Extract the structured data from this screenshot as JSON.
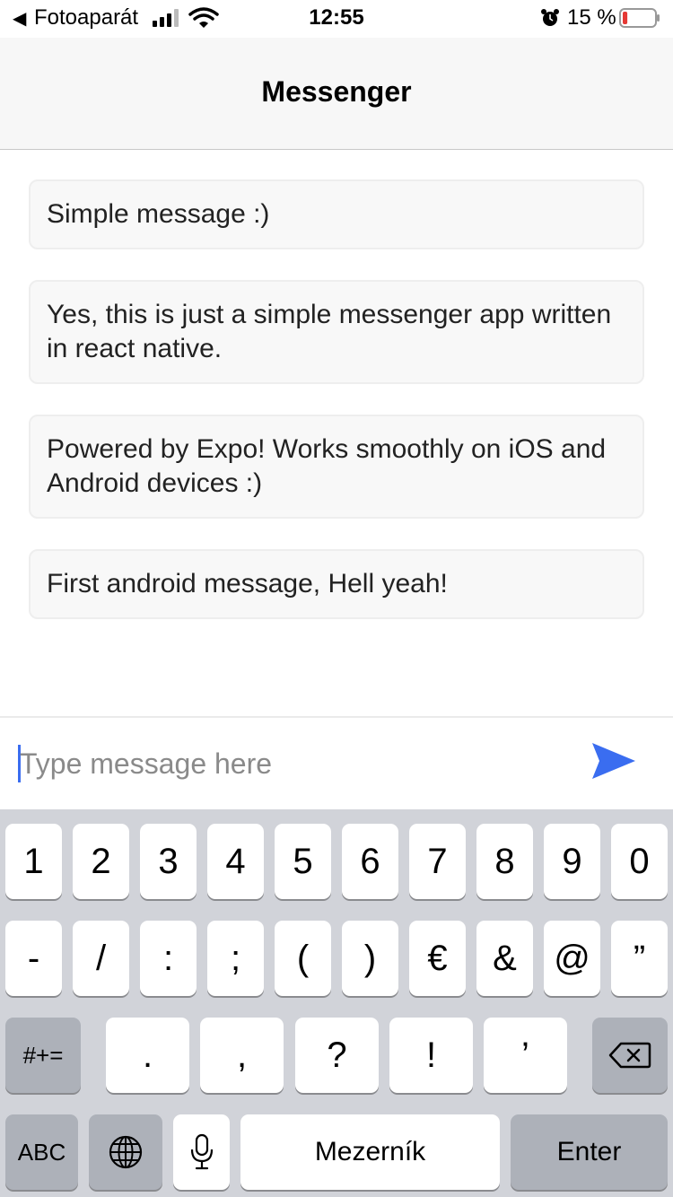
{
  "status_bar": {
    "back_app": "Fotoaparát",
    "time": "12:55",
    "battery_percent": "15 %",
    "battery_level": 0.15,
    "icons": [
      "back-arrow-icon",
      "signal-icon",
      "wifi-icon",
      "alarm-icon",
      "battery-icon"
    ]
  },
  "header": {
    "title": "Messenger"
  },
  "messages": [
    "Simple message :)",
    "Yes, this is just a simple messenger app written in react native.",
    "Powered by Expo! Works smoothly on iOS and Android devices :)",
    "First android message, Hell yeah!"
  ],
  "composer": {
    "placeholder": "Type message here",
    "value": "",
    "send_icon": "send-arrow-icon",
    "accent_color": "#3a6df0"
  },
  "keyboard": {
    "row1": [
      "1",
      "2",
      "3",
      "4",
      "5",
      "6",
      "7",
      "8",
      "9",
      "0"
    ],
    "row2": [
      "-",
      "/",
      ":",
      ";",
      "(",
      ")",
      "€",
      "&",
      "@",
      "”"
    ],
    "row3_mode": "#+=",
    "row3": [
      ".",
      ",",
      "?",
      "!",
      "’"
    ],
    "backspace_icon": "backspace-icon",
    "abc": "ABC",
    "globe_icon": "globe-icon",
    "mic_icon": "microphone-icon",
    "space": "Mezerník",
    "enter": "Enter"
  }
}
